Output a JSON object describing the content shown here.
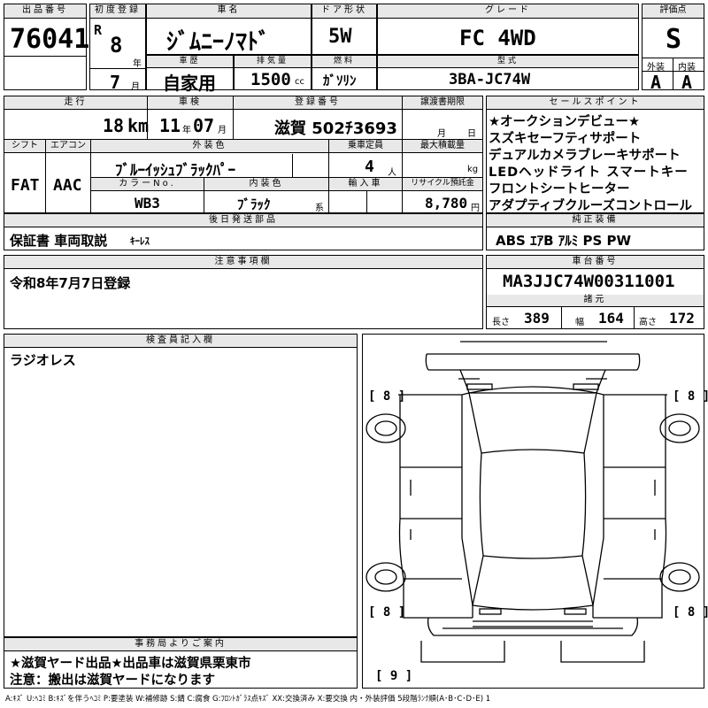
{
  "lot": {
    "label": "出品番号",
    "value": "76041"
  },
  "first_reg": {
    "label": "初度登録",
    "era": "R",
    "year": "8",
    "year_unit": "年",
    "month": "7",
    "month_unit": "月"
  },
  "car_name": {
    "label": "車名",
    "value": "ｼﾞﾑﾆｰﾉﾏﾄﾞ"
  },
  "door": {
    "label": "ドア形状",
    "value": "5W"
  },
  "grade": {
    "label": "グレード",
    "value": "FC 4WD"
  },
  "score": {
    "label": "評価点",
    "value": "S",
    "exterior_label": "外装",
    "interior_label": "内装",
    "exterior": "A",
    "interior": "A"
  },
  "history": {
    "label": "車歴",
    "value": "自家用"
  },
  "displacement": {
    "label": "排気量",
    "value": "1500",
    "unit": "cc"
  },
  "fuel": {
    "label": "燃料",
    "value": "ｶﾞｿﾘﾝ"
  },
  "model": {
    "label": "型式",
    "value": "3BA-JC74W"
  },
  "mileage": {
    "label": "走行",
    "value": "18",
    "unit": "km"
  },
  "inspection": {
    "label": "車検",
    "year": "11",
    "year_unit": "年",
    "month": "07",
    "month_unit": "月"
  },
  "plate": {
    "label": "登録番号",
    "value": "滋賀 502ﾁ3693"
  },
  "transfer": {
    "label": "譲渡書期限",
    "month_unit": "月",
    "day_unit": "日"
  },
  "shift": {
    "label": "シフト",
    "value": "FAT"
  },
  "aircon": {
    "label": "エアコン",
    "value": "AAC"
  },
  "ext_color": {
    "label": "外装色",
    "value": "ﾌﾞﾙｰｲｯｼｭﾌﾞﾗｯｸﾊﾟｰ"
  },
  "capacity": {
    "label": "乗車定員",
    "value": "4",
    "unit": "人"
  },
  "max_load": {
    "label": "最大積載量",
    "unit": "kg"
  },
  "color_no": {
    "label": "カラーNo.",
    "value": "WB3"
  },
  "int_color": {
    "label": "内装色",
    "value": "ﾌﾞﾗｯｸ",
    "unit": "系"
  },
  "import": {
    "label": "輸入車"
  },
  "recycle": {
    "label": "リサイクル預託金",
    "value": "8,780",
    "unit": "円"
  },
  "sales_points": {
    "label": "セールスポイント",
    "items": [
      "★オークションデビュー★",
      "スズキセーフティサポート",
      "デュアルカメラブレーキサポート",
      "LEDヘッドライト スマートキー",
      "フロントシートヒーター",
      "アダプティブクルーズコントロール"
    ]
  },
  "later_parts": {
    "label": "後日発送部品",
    "value": "保証書 車両取説",
    "value2": "ｷｰﾚｽ"
  },
  "equipment": {
    "label": "純正装備",
    "value": "ABS ｴｱB ｱﾙﾐ PS PW"
  },
  "notes": {
    "label": "注意事項欄",
    "value": "令和8年7月7日登録"
  },
  "chassis": {
    "label": "車台番号",
    "value": "MA3JJC74W00311001"
  },
  "specs": {
    "label": "諸元",
    "length_label": "長さ",
    "length": "389",
    "width_label": "幅",
    "width": "164",
    "height_label": "高さ",
    "height": "172"
  },
  "inspector": {
    "label": "検査員記入欄",
    "value": "ラジオレス"
  },
  "office": {
    "label": "事務局よりご案内",
    "line1": "★滋賀ヤード出品★出品車は滋賀県栗東市",
    "line2": "注意：搬出は滋賀ヤードになります"
  },
  "diagram": {
    "fl": "8",
    "fr": "8",
    "rl": "8",
    "rr": "8",
    "spare": "9"
  },
  "legend": "A:ｷｽﾞ U:ﾍｺﾐ B:ｷｽﾞを伴うﾍｺﾐ P:要塗装 W:補修跡 S:錆 C:腐食 G:ﾌﾛﾝﾄｶﾞﾗｽ点ｷｽﾞ XX:交換済み X:要交換 内・外装評価 5段階ﾗﾝｸ順(A･B･C･D･E) 1"
}
